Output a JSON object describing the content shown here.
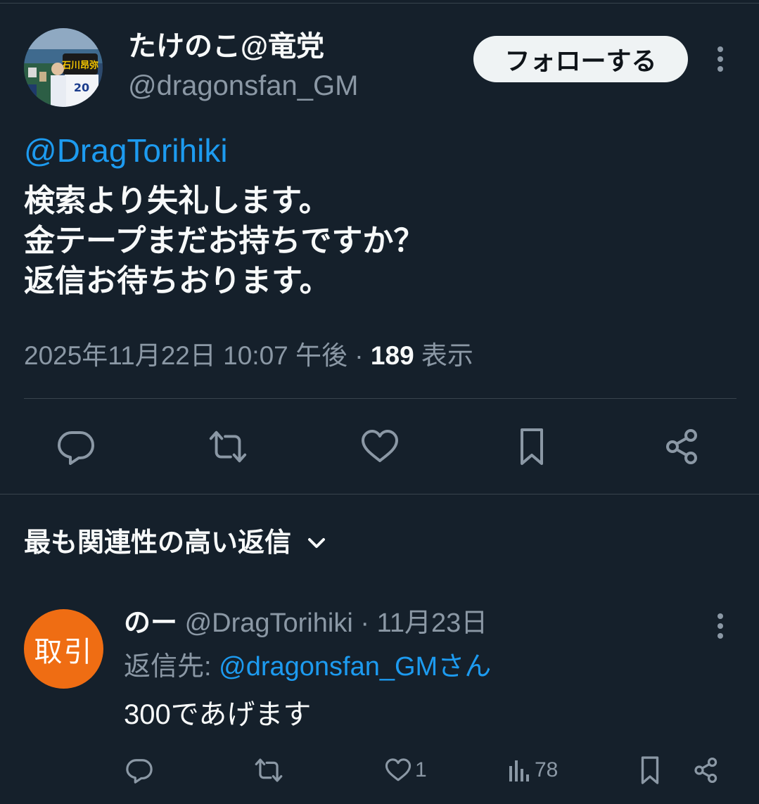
{
  "tweet": {
    "display_name": "たけのこ@竜党",
    "handle": "@dragonsfan_GM",
    "follow_label": "フォローする",
    "mention": "@DragTorihiki",
    "lines": [
      "検索より失礼します。",
      "金テープまだお持ちですか？",
      "返信お待ちおります。"
    ],
    "timestamp": "2025年11月22日 10:07 午後",
    "separator": " · ",
    "views_count": "189",
    "views_label": " 表示",
    "avatar_banner_text": "石川昂弥",
    "avatar_number": "20"
  },
  "actions": [
    "reply-icon",
    "retweet-icon",
    "like-icon",
    "bookmark-icon",
    "share-icon"
  ],
  "sort": {
    "label": "最も関連性の高い返信"
  },
  "reply": {
    "avatar_text": "取引",
    "avatar_color": "#ef6d13",
    "name": "のー",
    "handle": "@DragTorihiki",
    "dot": " · ",
    "date": "11月23日",
    "reply_to_label": "返信先: ",
    "reply_to_handle": "@dragonsfan_GMさん",
    "text": "300であげます",
    "likes": "1",
    "views": "78"
  },
  "colors": {
    "background": "#15202b",
    "accent": "#1d9bf0",
    "muted": "#8b98a5",
    "text": "#f7f9f9"
  }
}
